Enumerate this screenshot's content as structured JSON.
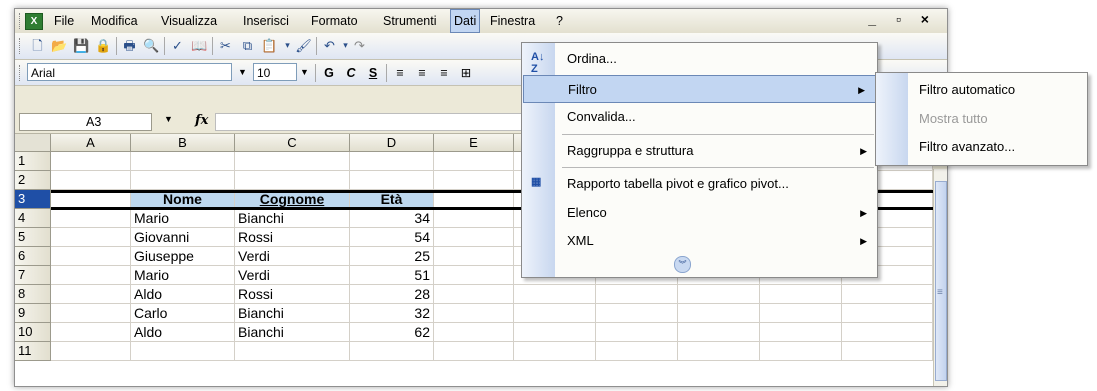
{
  "menubar": {
    "items": [
      "File",
      "Modifica",
      "Visualizza",
      "Inserisci",
      "Formato",
      "Strumenti",
      "Dati",
      "Finestra",
      "?"
    ],
    "window_controls": "_ ▫ ×"
  },
  "format_toolbar": {
    "font": "Arial",
    "size": "10",
    "bold": "G",
    "italic": "C",
    "underline": "S"
  },
  "formula_bar": {
    "cell_ref": "A3",
    "fx_label": "fx"
  },
  "columns": [
    "A",
    "B",
    "C",
    "D",
    "E"
  ],
  "rows": [
    "1",
    "2",
    "3",
    "4",
    "5",
    "6",
    "7",
    "8",
    "9",
    "10",
    "11"
  ],
  "table": {
    "headers": [
      "Nome",
      "Cognome",
      "Età"
    ],
    "rows": [
      [
        "Mario",
        "Bianchi",
        "34"
      ],
      [
        "Giovanni",
        "Rossi",
        "54"
      ],
      [
        "Giuseppe",
        "Verdi",
        "25"
      ],
      [
        "Mario",
        "Verdi",
        "51"
      ],
      [
        "Aldo",
        "Rossi",
        "28"
      ],
      [
        "Carlo",
        "Bianchi",
        "32"
      ],
      [
        "Aldo",
        "Bianchi",
        "62"
      ]
    ]
  },
  "dati_menu": {
    "items": [
      {
        "label": "Ordina...",
        "icon": "sort-az-icon"
      },
      {
        "label": "Filtro",
        "submenu": true,
        "highlighted": true
      },
      {
        "label": "Convalida..."
      },
      {
        "label": "Raggruppa e struttura",
        "submenu": true
      },
      {
        "label": "Rapporto tabella pivot e grafico pivot...",
        "icon": "pivot-icon"
      },
      {
        "label": "Elenco",
        "submenu": true
      },
      {
        "label": "XML",
        "submenu": true
      }
    ]
  },
  "filtro_submenu": {
    "items": [
      {
        "label": "Filtro automatico"
      },
      {
        "label": "Mostra tutto",
        "disabled": true
      },
      {
        "label": "Filtro avanzato..."
      }
    ]
  },
  "colors": {
    "accent": "#c2d6f2",
    "selected_row": "#1f4fa6",
    "header_fill": "#bdd7ee"
  }
}
